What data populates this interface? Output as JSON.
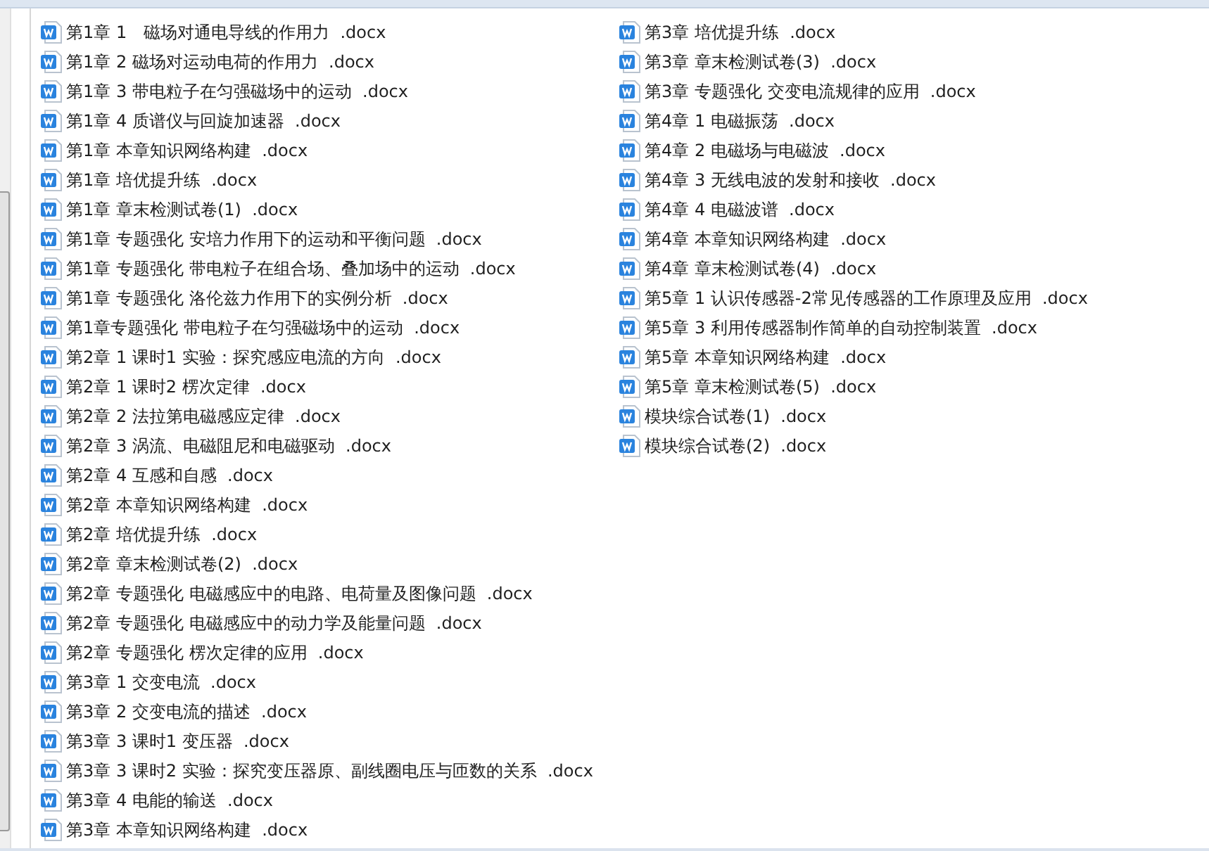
{
  "files": [
    {
      "name": "第1章 1　磁场对通电导线的作用力  .docx"
    },
    {
      "name": "第1章 2 磁场对运动电荷的作用力  .docx"
    },
    {
      "name": "第1章 3 带电粒子在匀强磁场中的运动  .docx"
    },
    {
      "name": "第1章 4 质谱仪与回旋加速器  .docx"
    },
    {
      "name": "第1章 本章知识网络构建  .docx"
    },
    {
      "name": "第1章 培优提升练  .docx"
    },
    {
      "name": "第1章 章末检测试卷(1)  .docx"
    },
    {
      "name": "第1章 专题强化 安培力作用下的运动和平衡问题  .docx"
    },
    {
      "name": "第1章 专题强化 带电粒子在组合场、叠加场中的运动  .docx"
    },
    {
      "name": "第1章 专题强化 洛伦兹力作用下的实例分析  .docx"
    },
    {
      "name": "第1章专题强化 带电粒子在匀强磁场中的运动  .docx"
    },
    {
      "name": "第2章 1 课时1 实验：探究感应电流的方向  .docx"
    },
    {
      "name": "第2章 1 课时2 楞次定律  .docx"
    },
    {
      "name": "第2章 2 法拉第电磁感应定律  .docx"
    },
    {
      "name": "第2章 3 涡流、电磁阻尼和电磁驱动  .docx"
    },
    {
      "name": "第2章 4 互感和自感  .docx"
    },
    {
      "name": "第2章 本章知识网络构建  .docx"
    },
    {
      "name": "第2章 培优提升练  .docx"
    },
    {
      "name": "第2章 章末检测试卷(2)  .docx"
    },
    {
      "name": "第2章 专题强化 电磁感应中的电路、电荷量及图像问题  .docx"
    },
    {
      "name": "第2章 专题强化 电磁感应中的动力学及能量问题  .docx"
    },
    {
      "name": "第2章 专题强化 楞次定律的应用  .docx"
    },
    {
      "name": "第3章 1 交变电流  .docx"
    },
    {
      "name": "第3章 2 交变电流的描述  .docx"
    },
    {
      "name": "第3章 3 课时1 变压器  .docx"
    },
    {
      "name": "第3章 3 课时2 实验：探究变压器原、副线圈电压与匝数的关系  .docx"
    },
    {
      "name": "第3章 4 电能的输送  .docx"
    },
    {
      "name": "第3章 本章知识网络构建  .docx"
    },
    {
      "name": "第3章 培优提升练  .docx"
    },
    {
      "name": "第3章 章末检测试卷(3)  .docx"
    },
    {
      "name": "第3章 专题强化 交变电流规律的应用  .docx"
    },
    {
      "name": "第4章 1 电磁振荡  .docx"
    },
    {
      "name": "第4章 2 电磁场与电磁波  .docx"
    },
    {
      "name": "第4章 3 无线电波的发射和接收  .docx"
    },
    {
      "name": "第4章 4 电磁波谱  .docx"
    },
    {
      "name": "第4章 本章知识网络构建  .docx"
    },
    {
      "name": "第4章 章末检测试卷(4)  .docx"
    },
    {
      "name": "第5章 1 认识传感器-2常见传感器的工作原理及应用  .docx"
    },
    {
      "name": "第5章 3 利用传感器制作简单的自动控制装置  .docx"
    },
    {
      "name": "第5章 本章知识网络构建  .docx"
    },
    {
      "name": "第5章 章末检测试卷(5)  .docx"
    },
    {
      "name": "模块综合试卷(1)  .docx"
    },
    {
      "name": "模块综合试卷(2)  .docx"
    }
  ]
}
